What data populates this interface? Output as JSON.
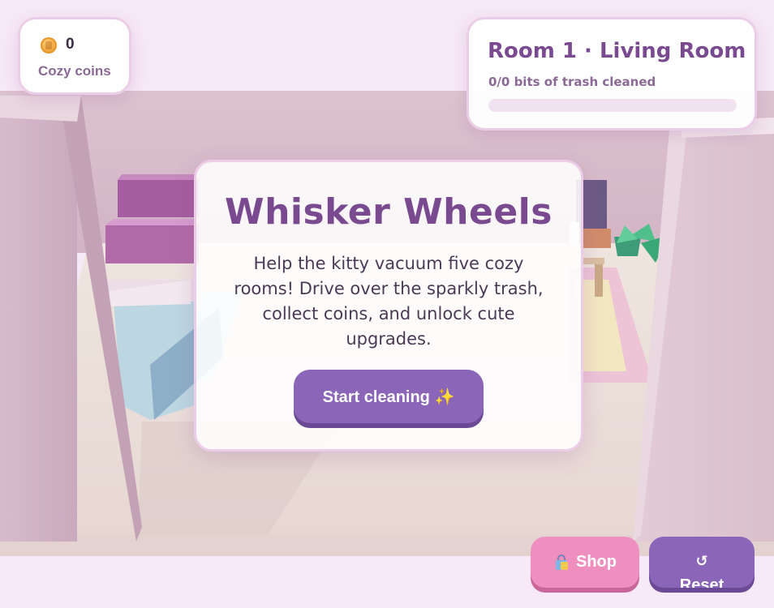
{
  "hud": {
    "coins": {
      "icon": "coin-icon",
      "value": "0",
      "label": "Cozy coins"
    },
    "room": {
      "title": "Room 1 · Living Room",
      "progress_text": "0/0 bits of trash cleaned",
      "progress_fraction": 0
    }
  },
  "intro": {
    "title": "Whisker Wheels",
    "description": "Help the kitty vacuum five cozy rooms! Drive over the sparkly trash, collect coins, and unlock cute upgrades.",
    "start_label": "Start cleaning ✨"
  },
  "controls": {
    "shop_icon": "shopping-bag-icon",
    "shop_label": "Shop",
    "reset_icon": "↺",
    "reset_label": "Reset"
  },
  "colors": {
    "accent": "#8b65b8",
    "title": "#7a4a90",
    "shop": "#ee8fbf",
    "panel_border": "#eccde8",
    "wall": "#d9bfcc",
    "floor": "#eee0dc"
  }
}
